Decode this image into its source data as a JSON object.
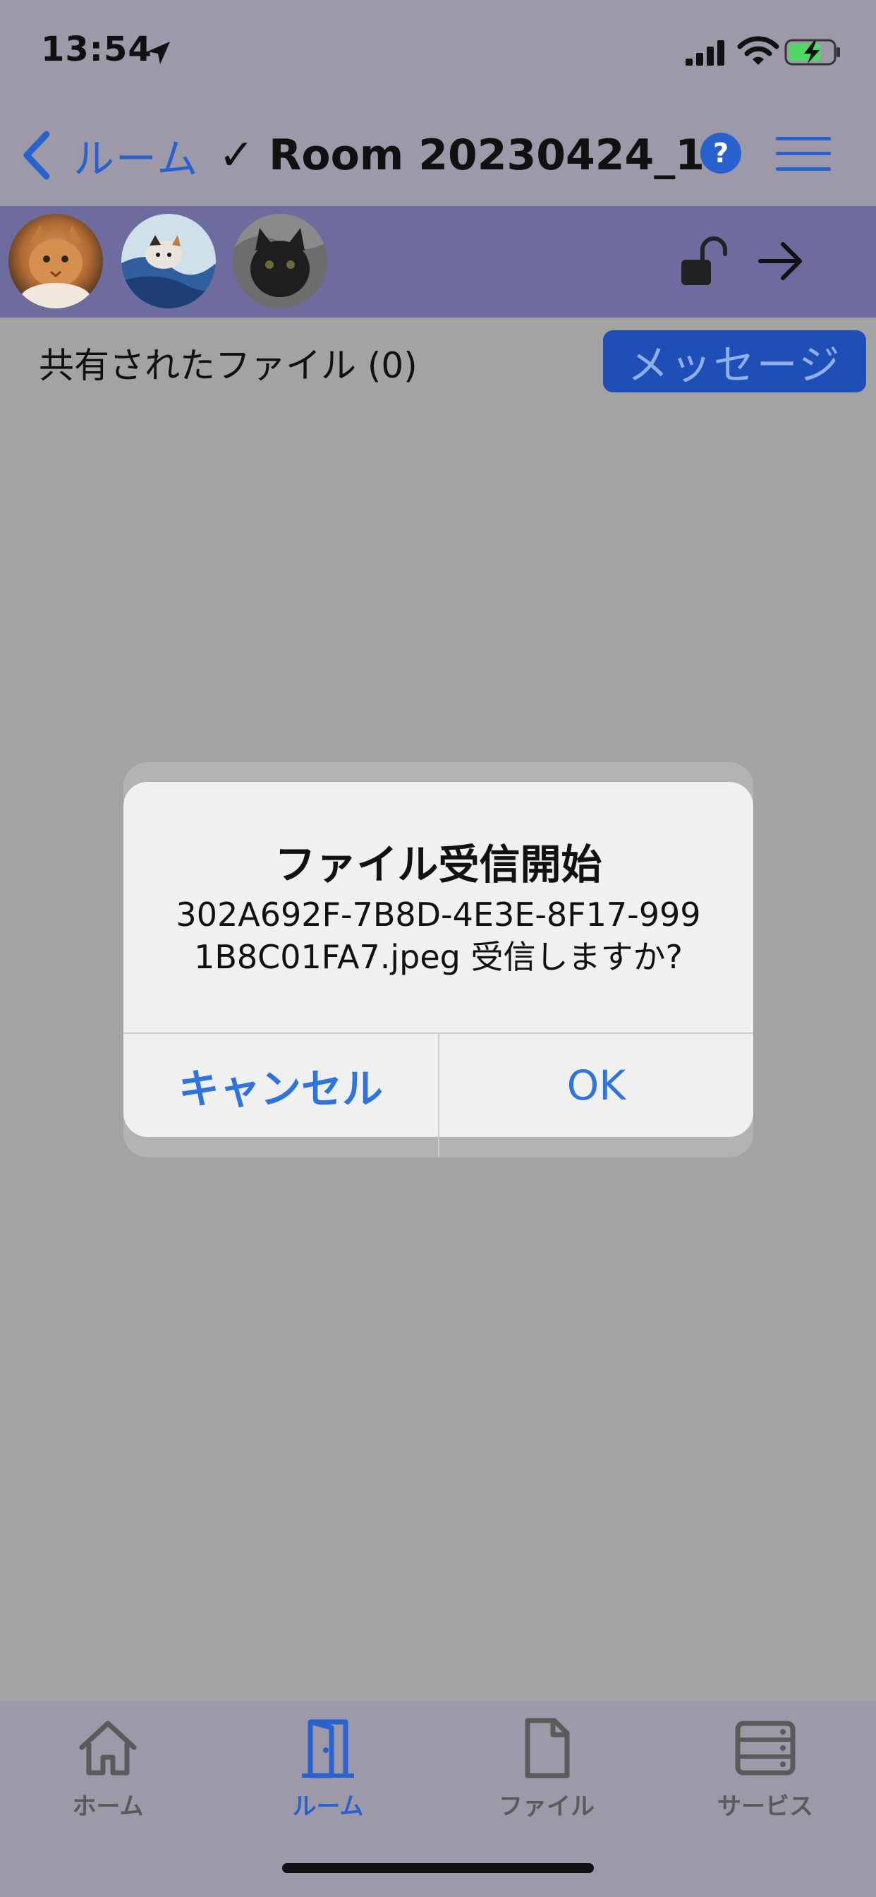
{
  "status_bar": {
    "time": "13:54"
  },
  "nav": {
    "back_label": "ルーム",
    "title": "✓ Room 20230424_1",
    "help_label": "?"
  },
  "members": {
    "avatars": [
      "cat-orange",
      "cat-calico",
      "cat-black"
    ]
  },
  "content": {
    "shared_files_label": "共有されたファイル (0)",
    "message_button": "メッセージ"
  },
  "dialog": {
    "title": "ファイル受信開始",
    "message_line1": "302A692F-7B8D-4E3E-8F17-999",
    "message_line2": "1B8C01FA7.jpeg 受信しますか?",
    "cancel_label": "キャンセル",
    "ok_label": "OK"
  },
  "tabs": [
    {
      "label": "ホーム",
      "icon": "home-icon"
    },
    {
      "label": "ルーム",
      "icon": "door-icon"
    },
    {
      "label": "ファイル",
      "icon": "file-icon"
    },
    {
      "label": "サービス",
      "icon": "server-icon"
    }
  ],
  "colors": {
    "accent": "#2762cf",
    "bar": "#9e99a9",
    "member_bar": "#6e6c9f",
    "dim_background": "#a3a3a3"
  }
}
